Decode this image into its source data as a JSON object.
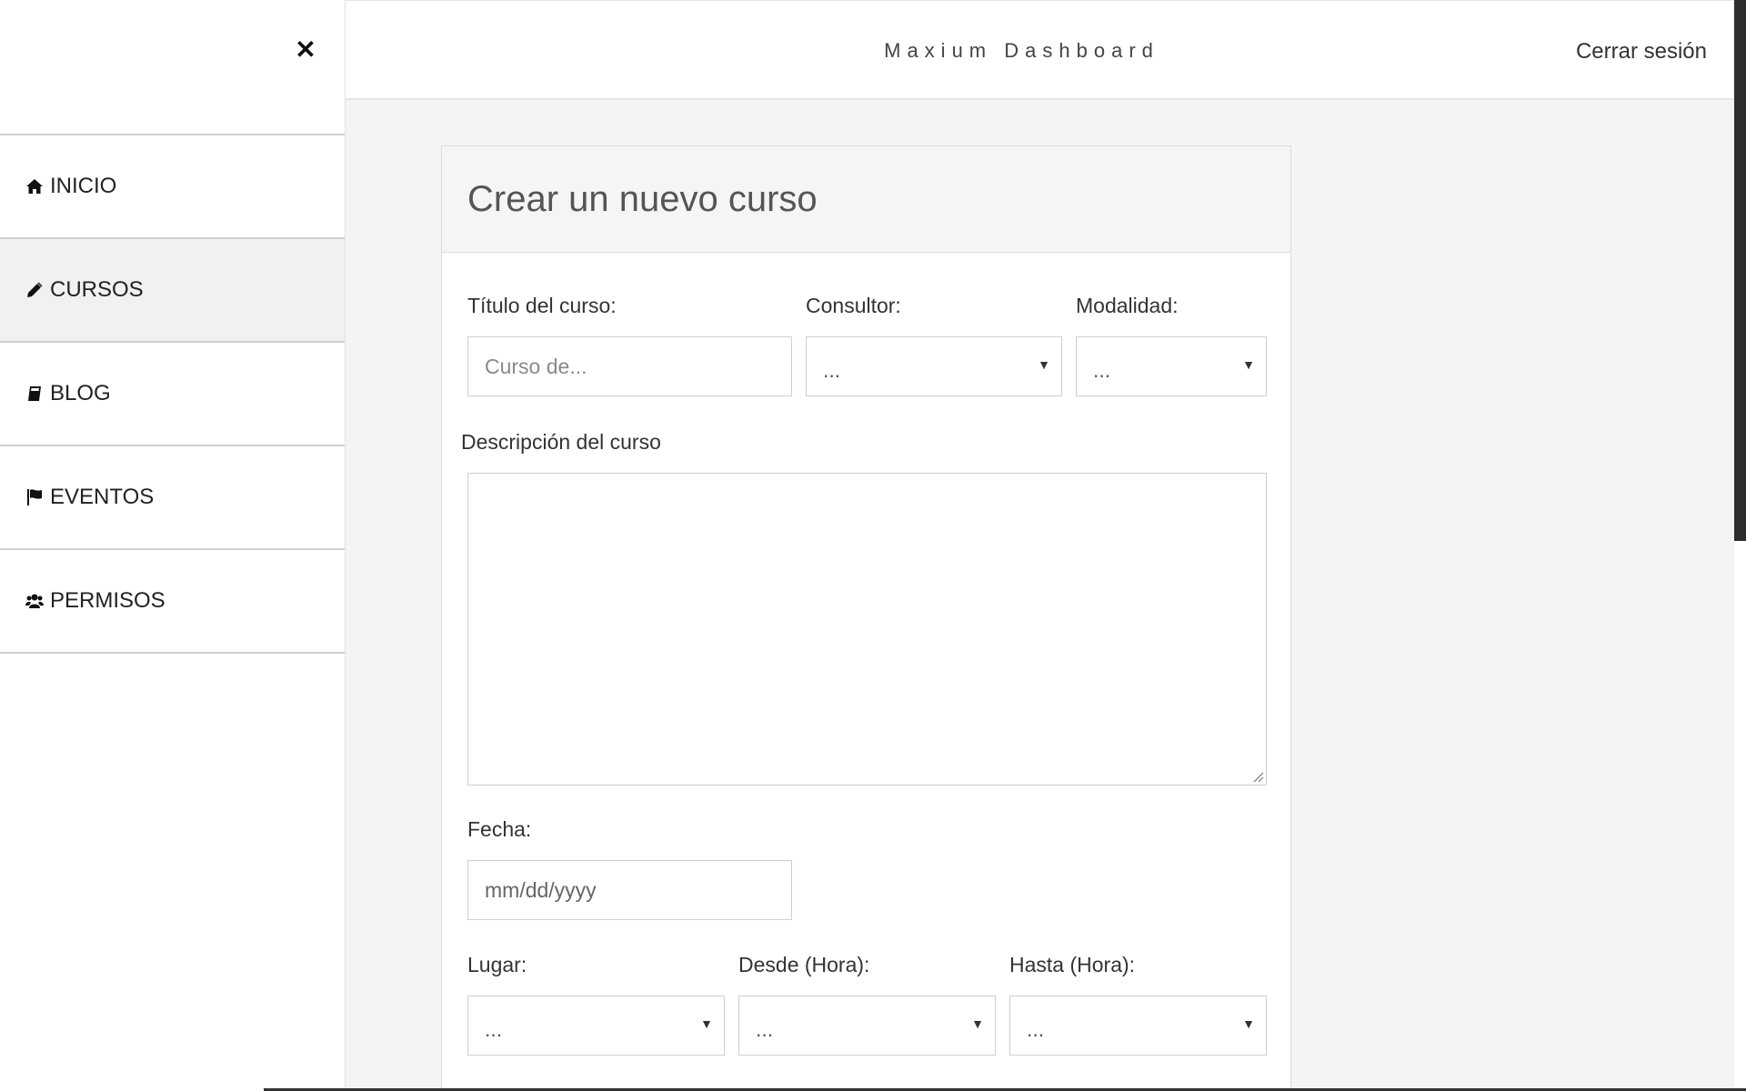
{
  "sidebar": {
    "close_icon": "close-icon",
    "items": [
      {
        "label": "INICIO",
        "icon": "home-icon"
      },
      {
        "label": "CURSOS",
        "icon": "pencil-icon",
        "active": true
      },
      {
        "label": "BLOG",
        "icon": "book-icon"
      },
      {
        "label": "EVENTOS",
        "icon": "flag-icon"
      },
      {
        "label": "PERMISOS",
        "icon": "users-icon"
      }
    ]
  },
  "header": {
    "brand": "Maxium Dashboard",
    "logout": "Cerrar sesión"
  },
  "form": {
    "title": "Crear un nuevo curso",
    "course_title_label": "Título del curso:",
    "course_title_placeholder": "Curso de...",
    "consultant_label": "Consultor:",
    "consultant_value": "...",
    "modality_label": "Modalidad:",
    "modality_value": "...",
    "description_label": "Descripción del curso",
    "date_label": "Fecha:",
    "date_placeholder": "mm/dd/yyyy",
    "place_label": "Lugar:",
    "place_value": "...",
    "from_label": "Desde (Hora):",
    "from_value": "...",
    "to_label": "Hasta (Hora):",
    "to_value": "..."
  },
  "colors": {
    "sidebar_bg": "#ffffff",
    "content_bg": "#f4f4f4",
    "active_item_bg": "#f1f1f1",
    "border": "#cfcfcf"
  }
}
